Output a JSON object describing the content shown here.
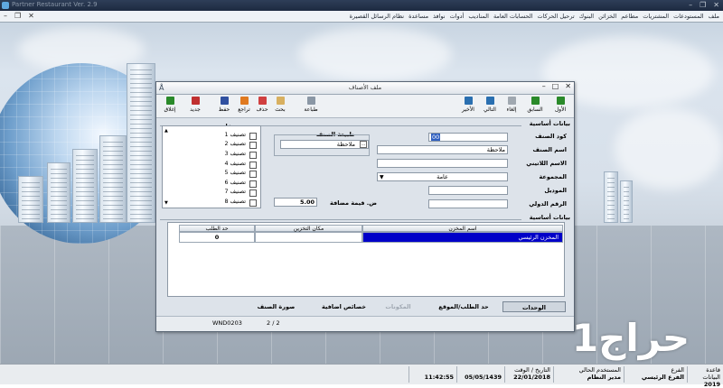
{
  "app": {
    "title": "Partner Restaurant Ver. 2.9"
  },
  "menu": [
    "ملف",
    "المستودعات",
    "المشتريات",
    "مطاعم",
    "الخزائن",
    "البنوك",
    "ترحيل الحركات",
    "الحسابات العامة",
    "المناديب",
    "أدوات",
    "نوافذ",
    "مساعدة",
    "نظام الرسائل القصيرة"
  ],
  "dialog": {
    "title": "ملف الأصناف",
    "toolbar": {
      "first": "الأول",
      "prev": "السابق",
      "next": "التالي",
      "last": "الأخير",
      "cancel": "إلغاء",
      "print": "طباعة",
      "search": "بحث",
      "delete": "حذف",
      "undo": "تراجع",
      "save": "حفظ",
      "new": "جديد",
      "close": "إغلاق"
    },
    "section_basic": "بيانات أساسية",
    "labels": {
      "code": "كود الصنف",
      "name": "اسم الصنف",
      "latin_name": "الاسم اللاتيني",
      "group": "المجموعة",
      "model": "الموديل",
      "intl_number": "الرقم الدولي",
      "item_nature": "طبيعة الصنف",
      "added_value": "ض. قيمة مضافة",
      "classifications": "تصنيفات"
    },
    "values": {
      "code": "00",
      "name": "ملاحظة",
      "latin_name": "",
      "group": "عامة",
      "model": "",
      "intl_number": "",
      "item_nature": "ملاحظة",
      "added_value": "5.00"
    },
    "classifications": [
      "تصنيف 1",
      "تصنيف 2",
      "تصنيف 3",
      "تصنيف 4",
      "تصنيف 5",
      "تصنيف 6",
      "تصنيف 7",
      "تصنيف 8"
    ],
    "grid": {
      "section": "بيانات أساسية",
      "columns": [
        "اسم المخزن",
        "مكان التخزين",
        "حد الطلب"
      ],
      "rows": [
        [
          "المخزن الرئيسي",
          "",
          "0"
        ]
      ]
    },
    "tabs": {
      "units": "الوحدات",
      "reorder": "حد الطلب/الموقع",
      "components": "المكونات",
      "extra": "خصائص اضافية",
      "image": "صورة الصنف"
    },
    "status": {
      "record": "2 / 2",
      "machine": "WND0203"
    }
  },
  "statusbar": {
    "db_label": "قاعدة البيانات",
    "db_value": "2019",
    "branch_label": "الفرع",
    "branch_value": "الفرع الرئيسي",
    "user_label": "المستخدم الحالي",
    "user_value": "مدير النظام",
    "date_label": "التاريخ / الوقت",
    "date_g": "22/01/2018",
    "date_h": "05/05/1439",
    "time": "11:42:55"
  },
  "watermark": "حراج1",
  "colors": {
    "selection": "#0000c8",
    "titlebar": "#1f2d44"
  }
}
